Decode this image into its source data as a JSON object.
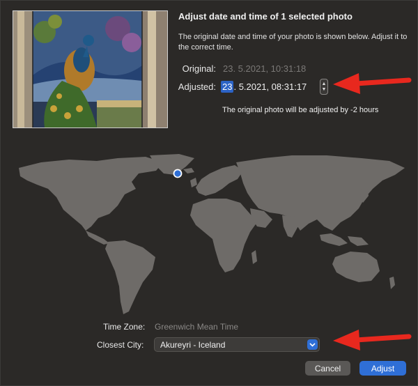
{
  "dialog": {
    "title": "Adjust date and time of 1 selected photo",
    "description": "The original date and time of your photo is shown below. Adjust it to the correct time."
  },
  "original": {
    "label": "Original:",
    "value": "23.  5.2021, 10:31:18"
  },
  "adjusted": {
    "label": "Adjusted:",
    "day": "23",
    "rest": ".  5.2021, 08:31:17"
  },
  "adjust_note": "The original photo will be adjusted by -2 hours",
  "timezone": {
    "label": "Time Zone:",
    "value": "Greenwich Mean Time"
  },
  "closest_city": {
    "label": "Closest City:",
    "value": "Akureyri - Iceland"
  },
  "buttons": {
    "cancel": "Cancel",
    "adjust": "Adjust"
  },
  "colors": {
    "background": "#2b2927",
    "map_land": "#6e6b68",
    "accent": "#2f6fd6",
    "annotation_arrow": "#e8281e"
  }
}
